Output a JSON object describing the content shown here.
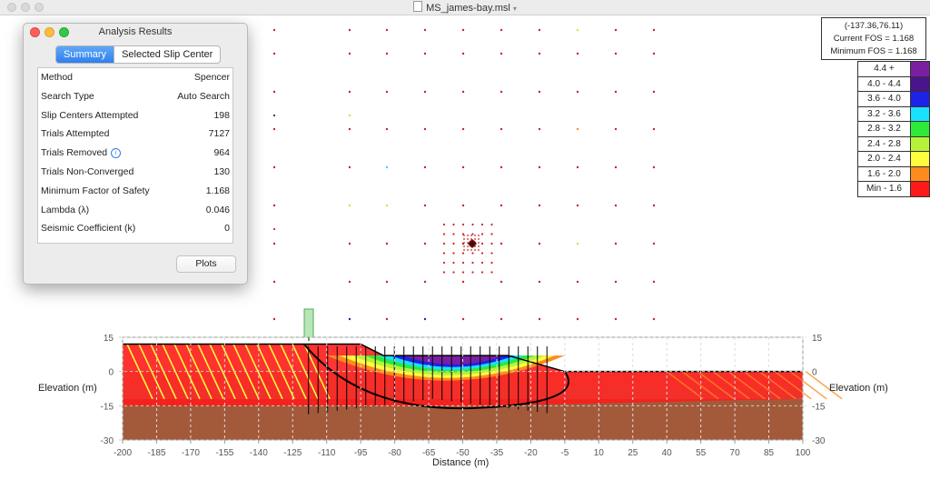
{
  "window": {
    "title": "MS_james-bay.msl"
  },
  "readout": {
    "coords": "(-137.36,76.11)",
    "current_fos": "Current FOS = 1.168",
    "minimum_fos": "Minimum FOS = 1.168"
  },
  "legend": [
    {
      "label": "4.4 +",
      "color": "#7b1fa2"
    },
    {
      "label": "4.0 - 4.4",
      "color": "#4a148c"
    },
    {
      "label": "3.6 - 4.0",
      "color": "#1e22e6"
    },
    {
      "label": "3.2 - 3.6",
      "color": "#19e0ff"
    },
    {
      "label": "2.8 - 3.2",
      "color": "#2ee83a"
    },
    {
      "label": "2.4 - 2.8",
      "color": "#b7f23a"
    },
    {
      "label": "2.0 - 2.4",
      "color": "#fffb3d"
    },
    {
      "label": "1.6 - 2.0",
      "color": "#ff8a1e"
    },
    {
      "label": "Min - 1.6",
      "color": "#ff1a1a"
    }
  ],
  "panel": {
    "title": "Analysis Results",
    "tabs": [
      {
        "label": "Summary",
        "active": true
      },
      {
        "label": "Selected Slip Center",
        "active": false
      }
    ],
    "rows": [
      {
        "key": "Method",
        "value": "Spencer"
      },
      {
        "key": "Search Type",
        "value": "Auto Search"
      },
      {
        "key": "Slip Centers Attempted",
        "value": "198"
      },
      {
        "key": "Trials Attempted",
        "value": "7127"
      },
      {
        "key": "Trials Removed",
        "value": "964",
        "info_icon": true
      },
      {
        "key": "Trials Non-Converged",
        "value": "130"
      },
      {
        "key": "Minimum Factor of Safety",
        "value": "1.168"
      },
      {
        "key": "Lambda (λ)",
        "value": "0.046"
      },
      {
        "key": "Seismic Coefficient (k)",
        "value": "0"
      }
    ],
    "plots_button": "Plots"
  },
  "axes": {
    "x_label": "Distance (m)",
    "y_label": "Elevation (m)",
    "x_ticks": [
      "-200",
      "-185",
      "-170",
      "-155",
      "-140",
      "-125",
      "-110",
      "-95",
      "-80",
      "-65",
      "-50",
      "-35",
      "-20",
      "-5",
      "10",
      "25",
      "40",
      "55",
      "70",
      "85",
      "100"
    ],
    "y_ticks": [
      "15",
      "0",
      "-15",
      "-30"
    ]
  }
}
